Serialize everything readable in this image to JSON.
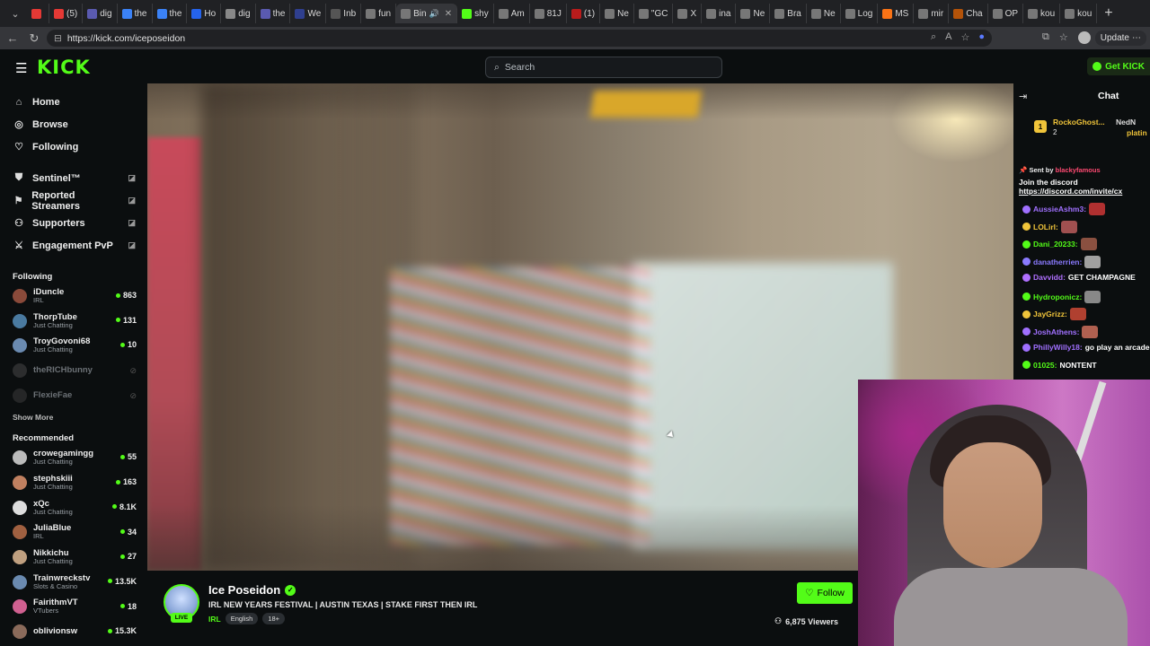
{
  "browser": {
    "tabs": [
      {
        "label": "",
        "color": "#e53935"
      },
      {
        "label": "(5)",
        "color": "#e53935"
      },
      {
        "label": "dig",
        "color": "#5a5ab0"
      },
      {
        "label": "the",
        "color": "#3b82f6"
      },
      {
        "label": "the",
        "color": "#3b82f6"
      },
      {
        "label": "Ho",
        "color": "#2563eb"
      },
      {
        "label": "dig",
        "color": "#888888"
      },
      {
        "label": "the",
        "color": "#5a5ab0"
      },
      {
        "label": "We",
        "color": "#2f3f8f"
      },
      {
        "label": "Inb",
        "color": "#555555"
      },
      {
        "label": "fun",
        "color": "#777777"
      },
      {
        "label": "Bin",
        "color": "#777777"
      },
      {
        "label": "shy",
        "color": "#53fc18"
      },
      {
        "label": "Am",
        "color": "#777777"
      },
      {
        "label": "81J",
        "color": "#777777"
      },
      {
        "label": "(1)",
        "color": "#b91c1c"
      },
      {
        "label": "Ne",
        "color": "#777777"
      },
      {
        "label": "\"GC",
        "color": "#777777"
      },
      {
        "label": "X",
        "color": "#777777"
      },
      {
        "label": "ina",
        "color": "#777777"
      },
      {
        "label": "Ne",
        "color": "#777777"
      },
      {
        "label": "Bra",
        "color": "#777777"
      },
      {
        "label": "Ne",
        "color": "#777777"
      },
      {
        "label": "Log",
        "color": "#777777"
      },
      {
        "label": "MS",
        "color": "#f97316"
      },
      {
        "label": "mir",
        "color": "#777777"
      },
      {
        "label": "Cha",
        "color": "#b45309"
      },
      {
        "label": "OP",
        "color": "#777777"
      },
      {
        "label": "kou",
        "color": "#777777"
      },
      {
        "label": "kou",
        "color": "#777777"
      }
    ],
    "url": "https://kick.com/iceposeidon",
    "update_label": "Update"
  },
  "header": {
    "logo": "KICK",
    "search_placeholder": "Search",
    "get_kick_label": "Get KICK"
  },
  "sidebar": {
    "nav": [
      {
        "label": "Home",
        "icon": "home-icon"
      },
      {
        "label": "Browse",
        "icon": "compass-icon"
      },
      {
        "label": "Following",
        "icon": "heart-icon"
      }
    ],
    "extensions": [
      {
        "label": "Sentinel™",
        "icon": "shield-icon"
      },
      {
        "label": "Reported Streamers",
        "icon": "flag-icon"
      },
      {
        "label": "Supporters",
        "icon": "people-icon"
      },
      {
        "label": "Engagement PvP",
        "icon": "swords-icon"
      }
    ],
    "following_title": "Following",
    "following": [
      {
        "name": "iDuncle",
        "category": "IRL",
        "viewers": "863",
        "avatar": "#8a4a3a",
        "online": true
      },
      {
        "name": "ThorpTube",
        "category": "Just Chatting",
        "viewers": "131",
        "avatar": "#4a7aa0",
        "online": true
      },
      {
        "name": "TroyGovoni68",
        "category": "Just Chatting",
        "viewers": "10",
        "avatar": "#6a8ab0",
        "online": true
      },
      {
        "name": "theRICHbunny",
        "category": "",
        "viewers": "",
        "avatar": "#555555",
        "online": false
      },
      {
        "name": "FlexieFae",
        "category": "",
        "viewers": "",
        "avatar": "#444444",
        "online": false
      }
    ],
    "show_more": "Show More",
    "recommended_title": "Recommended",
    "recommended": [
      {
        "name": "crowegamingg",
        "category": "Just Chatting",
        "viewers": "55",
        "avatar": "#bbbbbb"
      },
      {
        "name": "stephskiii",
        "category": "Just Chatting",
        "viewers": "163",
        "avatar": "#c08060"
      },
      {
        "name": "xQc",
        "category": "Just Chatting",
        "viewers": "8.1K",
        "avatar": "#dddddd"
      },
      {
        "name": "JuliaBlue",
        "category": "IRL",
        "viewers": "34",
        "avatar": "#a06040"
      },
      {
        "name": "Nikkichu",
        "category": "Just Chatting",
        "viewers": "27",
        "avatar": "#c0a080"
      },
      {
        "name": "Trainwreckstv",
        "category": "Slots & Casino",
        "viewers": "13.5K",
        "avatar": "#6a8ab0"
      },
      {
        "name": "FairithmVT",
        "category": "VTubers",
        "viewers": "18",
        "avatar": "#d06090"
      },
      {
        "name": "oblivionsw",
        "category": "",
        "viewers": "15.3K",
        "avatar": "#8a6a5a"
      }
    ]
  },
  "stream": {
    "streamer": "Ice Poseidon",
    "live_label": "LIVE",
    "title": "IRL NEW YEARS FESTIVAL | AUSTIN TEXAS | STAKE FIRST THEN IRL",
    "category": "IRL",
    "tags": [
      "English",
      "18+"
    ],
    "follow_label": "Follow",
    "viewers": "6,875 Viewers"
  },
  "chat": {
    "title": "Chat",
    "gifter": "RockoGhost...",
    "gift_count": "2",
    "gifter2": "NedN",
    "gifter2_sub": "platin",
    "pinned_sent_by": "Sent by",
    "pinned_sender": "blackyfamous",
    "pinned_message": "Join the discord",
    "pinned_link": "https://discord.com/invite/cx",
    "messages": [
      {
        "user": "AussieAshm3:",
        "color": "#a070ff",
        "text": ""
      },
      {
        "user": "LOLirl:",
        "color": "#f0c43a",
        "text": ""
      },
      {
        "user": "Dani_20233:",
        "color": "#53fc18",
        "text": ""
      },
      {
        "user": "danatherrien:",
        "color": "#8a7aff",
        "text": ""
      },
      {
        "user": "Davvidd:",
        "color": "#b070ff",
        "text": "GET CHAMPAGNE"
      },
      {
        "user": "Hydroponicz:",
        "color": "#53fc18",
        "text": ""
      },
      {
        "user": "JayGrizz:",
        "color": "#f0c43a",
        "text": ""
      },
      {
        "user": "JoshAthens:",
        "color": "#a070ff",
        "text": ""
      },
      {
        "user": "PhillyWilly18:",
        "color": "#a070ff",
        "text": "go play an arcade gar"
      },
      {
        "user": "01025:",
        "color": "#53fc18",
        "text": "NONTENT"
      }
    ]
  }
}
